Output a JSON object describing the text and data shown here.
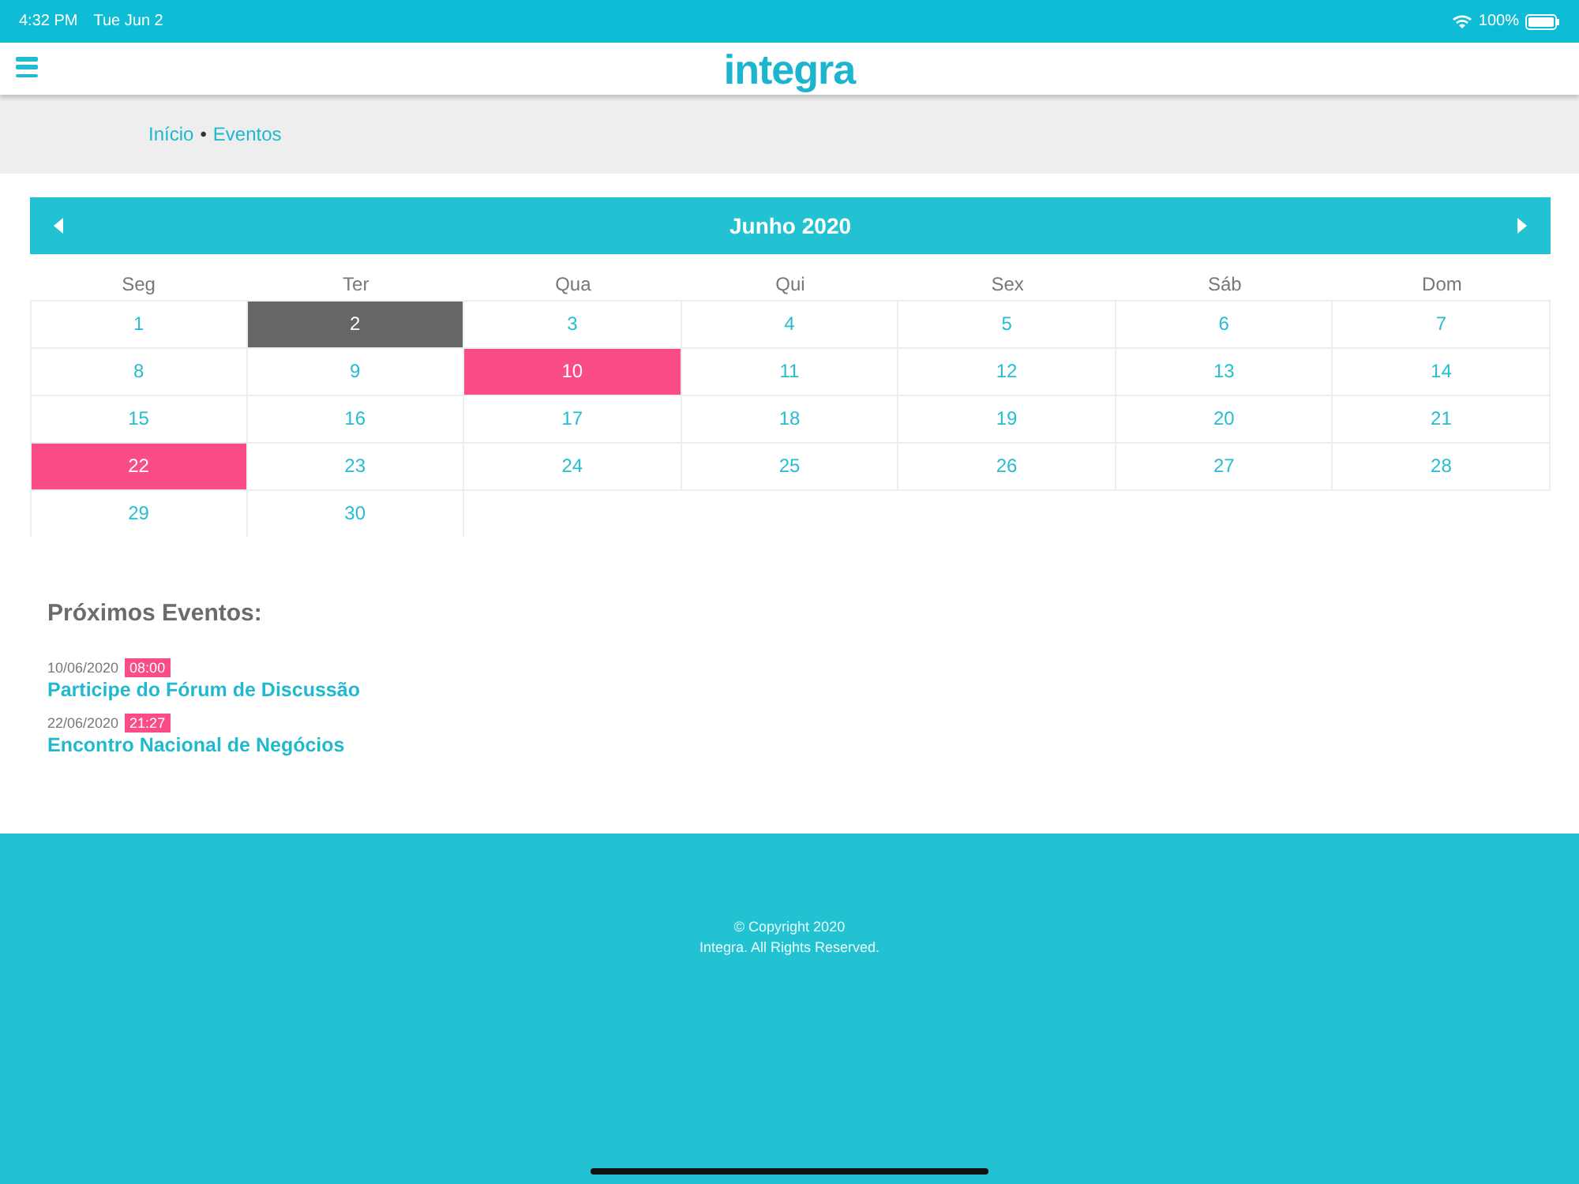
{
  "status_bar": {
    "time": "4:32 PM",
    "date": "Tue Jun 2",
    "battery": "100%"
  },
  "header": {
    "logo": "integra"
  },
  "breadcrumb": {
    "items": [
      "Início",
      "Eventos"
    ],
    "separator": "•"
  },
  "calendar": {
    "title": "Junho 2020",
    "weekdays": [
      "Seg",
      "Ter",
      "Qua",
      "Qui",
      "Sex",
      "Sáb",
      "Dom"
    ],
    "days": [
      {
        "label": "1",
        "kind": "plain"
      },
      {
        "label": "2",
        "kind": "today"
      },
      {
        "label": "3",
        "kind": "plain"
      },
      {
        "label": "4",
        "kind": "plain"
      },
      {
        "label": "5",
        "kind": "plain"
      },
      {
        "label": "6",
        "kind": "plain"
      },
      {
        "label": "7",
        "kind": "plain"
      },
      {
        "label": "8",
        "kind": "plain"
      },
      {
        "label": "9",
        "kind": "plain"
      },
      {
        "label": "10",
        "kind": "event"
      },
      {
        "label": "11",
        "kind": "plain"
      },
      {
        "label": "12",
        "kind": "plain"
      },
      {
        "label": "13",
        "kind": "plain"
      },
      {
        "label": "14",
        "kind": "plain"
      },
      {
        "label": "15",
        "kind": "plain"
      },
      {
        "label": "16",
        "kind": "plain"
      },
      {
        "label": "17",
        "kind": "plain"
      },
      {
        "label": "18",
        "kind": "plain"
      },
      {
        "label": "19",
        "kind": "plain"
      },
      {
        "label": "20",
        "kind": "plain"
      },
      {
        "label": "21",
        "kind": "plain"
      },
      {
        "label": "22",
        "kind": "event"
      },
      {
        "label": "23",
        "kind": "plain"
      },
      {
        "label": "24",
        "kind": "plain"
      },
      {
        "label": "25",
        "kind": "plain"
      },
      {
        "label": "26",
        "kind": "plain"
      },
      {
        "label": "27",
        "kind": "plain"
      },
      {
        "label": "28",
        "kind": "plain"
      },
      {
        "label": "29",
        "kind": "plain"
      },
      {
        "label": "30",
        "kind": "plain"
      }
    ]
  },
  "upcoming": {
    "title": "Próximos Eventos:",
    "events": [
      {
        "date": "10/06/2020",
        "time": "08:00",
        "title": "Participe do Fórum de Discussão"
      },
      {
        "date": "22/06/2020",
        "time": "21:27",
        "title": "Encontro Nacional de Negócios"
      }
    ]
  },
  "footer": {
    "lines": [
      "© Copyright 2020",
      "Integra. All Rights Reserved."
    ]
  }
}
